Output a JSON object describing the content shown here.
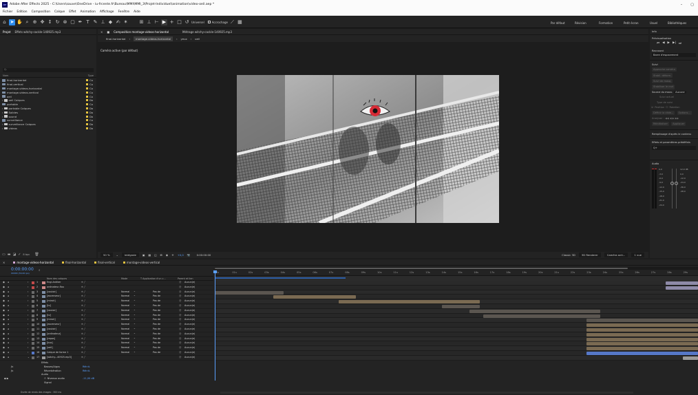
{
  "window": {
    "title": "Adobe After Effects 2025 - C:\\Users\\sauve\\OneDrive - iu-frcente.fr\\Bureau\\MMI\\MMI_3\\Projet-Individuel\\animation\\video-oeil.aep *",
    "app_icon": "Ae",
    "minimize": "–",
    "maximize": "▢"
  },
  "menu": [
    "Fichier",
    "Edition",
    "Composition",
    "Calque",
    "Effet",
    "Animation",
    "Affichage",
    "Fenêtre",
    "Aide"
  ],
  "toolbar": {
    "universal": "Universel",
    "snapping": "Accrochage",
    "workspaces": [
      "Par défaut",
      "Révision",
      "Formation",
      "Petit écran",
      "Usuel",
      "Bibliothèques"
    ]
  },
  "project": {
    "tabs": [
      "Projet",
      "Effets witchy-cackle-140925.mp3"
    ],
    "search_placeholder": "Q.",
    "columns": {
      "name": "Nom",
      "type": "Type"
    },
    "items": [
      {
        "name": "final-horizontal",
        "type": "Co",
        "kind": "comp",
        "label": "yellow",
        "indent": false
      },
      {
        "name": "final-vertical",
        "type": "Co",
        "kind": "comp",
        "label": "yellow",
        "indent": false
      },
      {
        "name": "montage-videos-horizontal",
        "type": "Co",
        "kind": "comp",
        "label": "yellow",
        "indent": false
      },
      {
        "name": "montage-videos-vertical",
        "type": "Co",
        "kind": "comp",
        "label": "yellow",
        "indent": false
      },
      {
        "name": "oeil",
        "type": "Co",
        "kind": "comp",
        "label": "yellow",
        "indent": false
      },
      {
        "name": "oeil Calques",
        "type": "Do",
        "kind": "folder",
        "label": "yellow",
        "indent": true
      },
      {
        "name": "portable",
        "type": "Co",
        "kind": "comp",
        "label": "yellow",
        "indent": false
      },
      {
        "name": "portable Calques",
        "type": "Do",
        "kind": "folder",
        "label": "yellow",
        "indent": true
      },
      {
        "name": "Solides",
        "type": "Do",
        "kind": "folder",
        "label": "yellow",
        "indent": true
      },
      {
        "name": "sound",
        "type": "Do",
        "kind": "folder",
        "label": "yellow",
        "indent": true
      },
      {
        "name": "surveillance",
        "type": "Co",
        "kind": "comp",
        "label": "yellow",
        "indent": false
      },
      {
        "name": "surveillance Calques",
        "type": "Do",
        "kind": "folder",
        "label": "yellow",
        "indent": true
      },
      {
        "name": "videos",
        "type": "Do",
        "kind": "folder",
        "label": "yellow",
        "indent": true
      }
    ],
    "bpc": "8 bpc"
  },
  "viewer": {
    "tabs": [
      "Composition montage-videos-horizontal",
      "Métrage witchy-cackle-140925.mp3"
    ],
    "breadcrumbs": [
      "final-horizontal",
      "montage-videos-horizontal",
      "yeux",
      "oeil"
    ],
    "camera_label": "Caméra active (par défaut)",
    "zoom": "50 %",
    "resolution": "Intégrale",
    "timecode": "0:00:00:00",
    "exposure": "+0,0",
    "renderer": "Classic 3D",
    "view_3d": "3D Renderer",
    "camera": "Caméra acti...",
    "view_count": "1 vue"
  },
  "right_panel": {
    "info": "Info",
    "preview": "Prévisualisation",
    "shortcut_label": "Raccourci",
    "shortcut_value": "Barre d'espacement",
    "follow": "Suivi",
    "track_buttons": [
      "Approche caméra",
      "Stabil. déform.",
      "Suivi de masq.",
      "Stabiliser le mvt"
    ],
    "motion_source": "Source du mouv.",
    "motion_source_value": "Aucune",
    "current_track": "Suivi actuel",
    "track_type": "Type de suivi",
    "position": "Position",
    "rotation": "Rotation",
    "scale": "Ech.",
    "edit_target": "Définir la cible...",
    "options": "Options...",
    "analyze": "Analyser :",
    "reset": "Réinitialiser",
    "apply": "Appliquer",
    "content_aware": "Remplissage d'après le contenu",
    "effects_presets": "Effets et paramètres prédéfinis",
    "effects_search": "Q+",
    "audio": "Audio",
    "audio_levels": [
      "0,0",
      "-3,0",
      "-6,0",
      "-9,0",
      "-12,0",
      "-15,0",
      "-18,0",
      "-21,0",
      "-24,0"
    ],
    "audio_levels_right": [
      "12,0 dB",
      "0,0",
      "-12,0",
      "-24,0",
      "-36,0",
      "-48,0"
    ]
  },
  "timeline": {
    "tabs": [
      "montage-videos-horizontal",
      "final-horizontal",
      "final-vertical",
      "montage-videos-vertical"
    ],
    "timecode": "0:00:00:00",
    "fps": "00000 (30,00 ips)",
    "col_name": "Nom des calques",
    "col_mode": "Mode",
    "col_trkmat": "T  Application d'un c...",
    "col_parent": "Parent et lien",
    "ruler": [
      "0s",
      "01s",
      "02s",
      "03s",
      "04s",
      "05s",
      "06s",
      "07s",
      "08s",
      "09s",
      "10s",
      "11s",
      "12s",
      "13s",
      "14s",
      "15s",
      "16s",
      "17s",
      "18s",
      "19s",
      "20s",
      "21s",
      "22s",
      "23s",
      "24s",
      "25s",
      "26s",
      "27s",
      "28s",
      "29s"
    ],
    "layers": [
      {
        "num": "1",
        "name": "Engl.Antiker",
        "type": "text",
        "mode": "",
        "parent": "Aucun(e)"
      },
      {
        "num": "2",
        "name": "ordinateur-flou",
        "type": "text",
        "mode": "",
        "parent": "Aucun(e)"
      },
      {
        "num": "3",
        "name": "[couloir]",
        "type": "video",
        "mode": "Normal",
        "parent": "Aucun(e)"
      },
      {
        "num": "4",
        "name": "[ascenseur]",
        "type": "video",
        "mode": "Normal",
        "parent": "Aucun(e)"
      },
      {
        "num": "5",
        "name": "[miroir]",
        "type": "video",
        "mode": "Normal",
        "parent": "Aucun(e)"
      },
      {
        "num": "6",
        "name": "[tv]",
        "type": "video",
        "mode": "Normal",
        "parent": "Aucun(e)"
      },
      {
        "num": "7",
        "name": "[couloir]",
        "type": "video",
        "mode": "Normal",
        "parent": "Aucun(e)"
      },
      {
        "num": "8",
        "name": "[tv]",
        "type": "video",
        "mode": "Normal",
        "parent": "Aucun(e)"
      },
      {
        "num": "9",
        "name": "[miroir]",
        "type": "video",
        "mode": "Normal",
        "parent": "Aucun(e)"
      },
      {
        "num": "10",
        "name": "[ascenseur]",
        "type": "video",
        "mode": "Normal",
        "parent": "Aucun(e)"
      },
      {
        "num": "11",
        "name": "[couloir]",
        "type": "video",
        "mode": "Normal",
        "parent": "Aucun(e)"
      },
      {
        "num": "12",
        "name": "[ordinateur]",
        "type": "video",
        "mode": "Normal",
        "parent": "Aucun(e)"
      },
      {
        "num": "13",
        "name": "[repos]",
        "type": "video",
        "mode": "Normal",
        "parent": "Aucun(e)"
      },
      {
        "num": "14",
        "name": "[bus]",
        "type": "video",
        "mode": "Normal",
        "parent": "Aucun(e)"
      },
      {
        "num": "15",
        "name": "[oeil]",
        "type": "comp",
        "mode": "Normal",
        "parent": "Aucun(e)"
      },
      {
        "num": "16",
        "name": "Calque de forme 1",
        "type": "shape",
        "mode": "Normal",
        "parent": "Aucun(e)"
      },
      {
        "num": "17",
        "name": "[witchy...40925.mp3]",
        "type": "audio",
        "mode": "",
        "parent": "Aucun(e)"
      }
    ],
    "track_mode_value": "Pas de",
    "sub_effects": "Effets",
    "sub_reverb": "Basses/Aigus",
    "sub_reverb2": "Réverbération",
    "sub_reset1": "Réinit.",
    "sub_reset2": "Réinit.",
    "sub_audio": "Audio",
    "sub_level": "Niveaux audio",
    "sub_level_value": "-11,00 dB",
    "sub_signal": "Signal",
    "bottom": "Durée de rendu des images : 300 ms"
  }
}
